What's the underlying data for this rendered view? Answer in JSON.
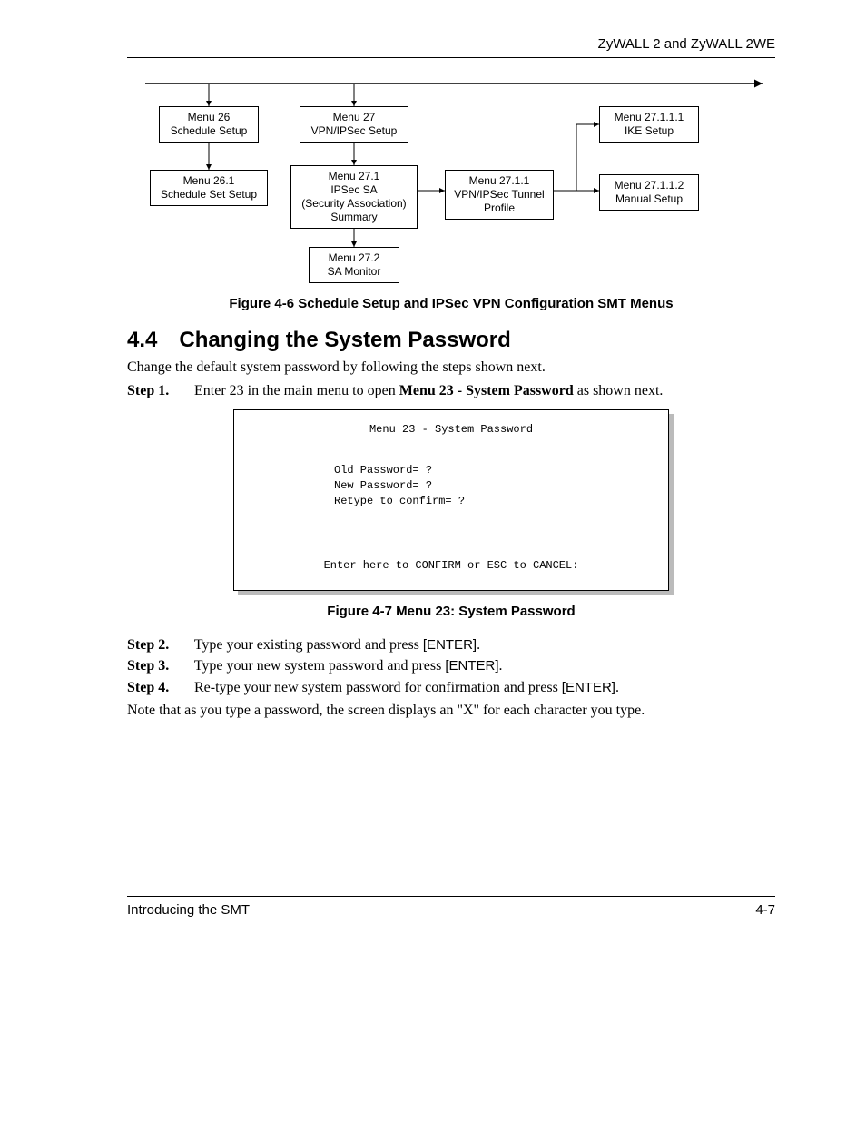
{
  "header": {
    "product": "ZyWALL 2 and ZyWALL 2WE"
  },
  "diagram": {
    "boxes": {
      "m26": {
        "l1": "Menu 26",
        "l2": "Schedule Setup"
      },
      "m261": {
        "l1": "Menu 26.1",
        "l2": "Schedule Set Setup"
      },
      "m27": {
        "l1": "Menu 27",
        "l2": "VPN/IPSec Setup"
      },
      "m271": {
        "l1": "Menu 27.1",
        "l2": "IPSec SA",
        "l3": "(Security Association)",
        "l4": "Summary"
      },
      "m272": {
        "l1": "Menu 27.2",
        "l2": "SA Monitor"
      },
      "m2711": {
        "l1": "Menu 27.1.1",
        "l2": "VPN/IPSec Tunnel",
        "l3": "Profile"
      },
      "m27111": {
        "l1": "Menu 27.1.1.1",
        "l2": "IKE Setup"
      },
      "m27112": {
        "l1": "Menu 27.1.1.2",
        "l2": "Manual Setup"
      }
    }
  },
  "fig6": {
    "caption": "Figure 4-6 Schedule Setup and IPSec VPN Configuration SMT Menus"
  },
  "section": {
    "number": "4.4",
    "title": "Changing the System Password",
    "intro": "Change the default system password by following the steps shown next.",
    "step1": {
      "label": "Step 1.",
      "text_a": "Enter 23 in the main menu to open ",
      "bold": "Menu 23 - System Password",
      "text_b": " as shown next."
    },
    "step2": {
      "label": "Step 2.",
      "text": "Type your existing password and press ",
      "key": "[ENTER]",
      "tail": "."
    },
    "step3": {
      "label": "Step 3.",
      "text": "Type your new system password and press ",
      "key": "[ENTER]",
      "tail": "."
    },
    "step4": {
      "label": "Step 4.",
      "text": "Re-type your new system password for confirmation and press ",
      "key": "[ENTER]",
      "tail": "."
    },
    "note": "Note that as you type a password, the screen displays an \"X\" for each character you type."
  },
  "terminal": {
    "title": "Menu 23 - System Password",
    "old": "Old Password= ?",
    "new": "New Password= ?",
    "retype": "Retype to confirm= ?",
    "confirm": "Enter here to CONFIRM or ESC to CANCEL:"
  },
  "fig7": {
    "caption": "Figure 4-7 Menu 23: System Password"
  },
  "footer": {
    "left": "Introducing the SMT",
    "right": "4-7"
  }
}
